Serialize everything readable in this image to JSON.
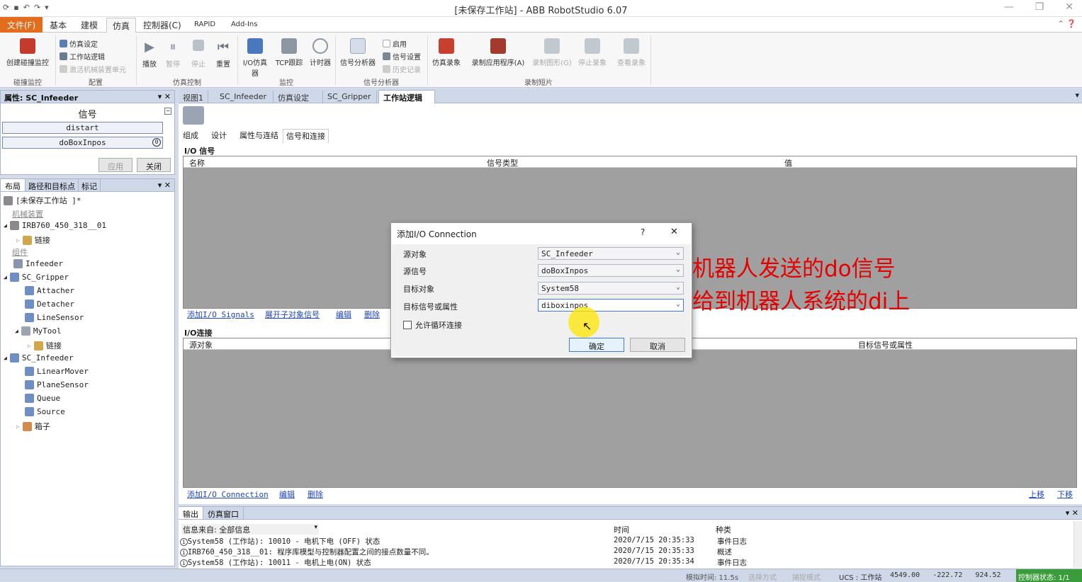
{
  "window": {
    "title": "[未保存工作站] - ABB RobotStudio 6.07",
    "qat_icons": [
      "refresh-icon",
      "save-icon",
      "undo-icon",
      "redo-icon",
      "dropdown-icon"
    ]
  },
  "ribbon_tabs": [
    {
      "label": "文件(F)"
    },
    {
      "label": "基本"
    },
    {
      "label": "建模"
    },
    {
      "label": "仿真"
    },
    {
      "label": "控制器(C)"
    },
    {
      "label": "RAPID"
    },
    {
      "label": "Add-Ins"
    }
  ],
  "ribbon": {
    "create_collision_monitor": "创建碰撞监控",
    "sim_setup": "仿真设定",
    "station_logic": "工作站逻辑",
    "activate_mech": "激活机械装置单元",
    "play": "播放",
    "pause": "暂停",
    "stop": "停止",
    "reset": "重置",
    "io_sim": "I/O仿真器",
    "tcp_trace": "TCP跟踪",
    "timer": "计时器",
    "signal_analyzer": "信号分析器",
    "enable": "启用",
    "signal_setup": "信号设置",
    "history": "历史记录",
    "sim_record": "仿真录象",
    "record_app": "录制应用程序(A)",
    "record_graphics": "录制图形(G)",
    "stop_record": "停止录象",
    "view_record": "查看录象",
    "groups": {
      "collision": "碰撞监控",
      "config": "配置",
      "sim_control": "仿真控制",
      "monitor": "监控",
      "signal_analysis": "信号分析器",
      "record_short": "录制短片"
    }
  },
  "properties_panel": {
    "title": "属性: SC_Infeeder",
    "section": "信号",
    "signals": [
      "distart",
      "doBoxInpos"
    ],
    "apply_button": "应用",
    "close_button": "关闭"
  },
  "layout_panel": {
    "tabs": [
      "布局",
      "路径和目标点",
      "标记"
    ],
    "station": "[未保存工作站 ]*",
    "mechanisms_header": "机械装置",
    "robot": "IRB760_450_318__01",
    "links": "链接",
    "components_header": "组件",
    "items": [
      "Infeeder",
      "SC_Gripper",
      "Attacher",
      "Detacher",
      "LineSensor",
      "MyTool",
      "链接",
      "SC_Infeeder",
      "LinearMover",
      "PlaneSensor",
      "Queue",
      "Source",
      "箱子"
    ]
  },
  "doc_tabs": [
    "视图1",
    "SC_Infeeder",
    "仿真设定",
    "SC_Gripper",
    "工作站逻辑"
  ],
  "logic": {
    "subtabs": [
      "组成",
      "设计",
      "属性与连结",
      "信号和连接"
    ],
    "io_signals_title": "I/O 信号",
    "io_cols": [
      "名称",
      "信号类型",
      "值"
    ],
    "signal_links": [
      "添加I/O Signals",
      "展开子对象信号",
      "编辑",
      "删除"
    ],
    "io_conn_title": "I/O连接",
    "conn_cols": [
      "源对象",
      "目标信号或属性"
    ],
    "conn_links": [
      "添加I/O Connection",
      "编辑",
      "删除"
    ],
    "move_up": "上移",
    "move_down": "下移"
  },
  "dialog": {
    "title": "添加I/O Connection",
    "help": "?",
    "close": "✕",
    "labels": [
      "源对象",
      "源信号",
      "目标对象",
      "目标信号或属性"
    ],
    "values": [
      "SC_Infeeder",
      "doBoxInpos",
      "System58",
      "diboxinpos"
    ],
    "allow_cycle": "允许循环连接",
    "ok": "确定",
    "cancel": "取消"
  },
  "annotation": {
    "line1": "机器人发送的do信号",
    "line2": "给到机器人系统的di上"
  },
  "output": {
    "tabs": [
      "输出",
      "仿真窗口"
    ],
    "source_label": "信息来自: 全部信息",
    "cols": [
      "时间",
      "种类"
    ],
    "rows": [
      {
        "msg": "System58 (工作站): 10010 - 电机下电 (OFF) 状态",
        "time": "2020/7/15 20:35:33",
        "kind": "事件日志"
      },
      {
        "msg": "IRB760_450_318__01: 程序库模型与控制器配置之间的接点数量不同。",
        "time": "2020/7/15 20:35:33",
        "kind": "概述"
      },
      {
        "msg": "System58 (工作站): 10011 - 电机上电(ON) 状态",
        "time": "2020/7/15 20:35:34",
        "kind": "事件日志"
      }
    ]
  },
  "statusbar": {
    "sim_time": "模拟时间: 11.5s",
    "select_mode": "选择方式",
    "snap_mode": "捕捉模式",
    "ucs": "UCS : 工作站",
    "coords": "4549.00   -222.72   924.52",
    "controller_status": "控制器状态: 1/1"
  },
  "colors": {
    "file_tab": "#e36c1d",
    "annotation": "#e60000",
    "link": "#1f47b8",
    "grid_bg": "#a0a0a0"
  }
}
